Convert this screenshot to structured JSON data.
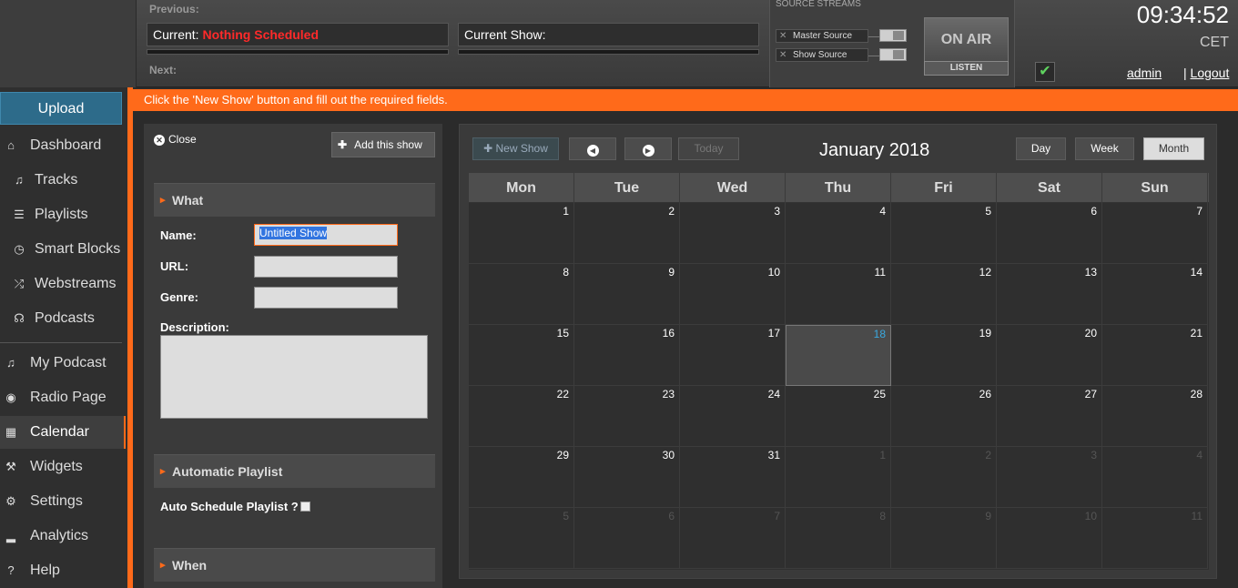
{
  "header": {
    "previous_label": "Previous:",
    "next_label": "Next:",
    "current_label": "Current:",
    "current_value": "Nothing Scheduled",
    "current_show_label": "Current Show:",
    "source_streams_title": "SOURCE STREAMS",
    "master_source": "Master Source",
    "show_source": "Show Source",
    "on_air": "ON AIR",
    "listen": "LISTEN",
    "time": "09:34:52",
    "timezone": "CET",
    "user": "admin",
    "logout_sep": "|",
    "logout": "Logout"
  },
  "sidebar": {
    "upload": "Upload",
    "items": [
      {
        "label": "Dashboard",
        "icon": "home-icon",
        "glyph": "⌂"
      },
      {
        "label": "Tracks",
        "icon": "music-note-icon",
        "glyph": "♫"
      },
      {
        "label": "Playlists",
        "icon": "list-icon",
        "glyph": "☰"
      },
      {
        "label": "Smart Blocks",
        "icon": "clock-icon",
        "glyph": "◷"
      },
      {
        "label": "Webstreams",
        "icon": "shuffle-icon",
        "glyph": "⤮"
      },
      {
        "label": "Podcasts",
        "icon": "headphones-icon",
        "glyph": "☊"
      },
      {
        "label": "My Podcast",
        "icon": "music-note-icon",
        "glyph": "♫"
      },
      {
        "label": "Radio Page",
        "icon": "globe-icon",
        "glyph": "◉"
      },
      {
        "label": "Calendar",
        "icon": "calendar-icon",
        "glyph": "▦"
      },
      {
        "label": "Widgets",
        "icon": "wrench-icon",
        "glyph": "⚒"
      },
      {
        "label": "Settings",
        "icon": "gear-icon",
        "glyph": "⚙"
      },
      {
        "label": "Analytics",
        "icon": "bar-chart-icon",
        "glyph": "▂"
      },
      {
        "label": "Help",
        "icon": "help-icon",
        "glyph": "?"
      }
    ],
    "active": "Calendar"
  },
  "notice": "Click the 'New Show' button and fill out the required fields.",
  "form": {
    "close": "Close",
    "add_show": "Add this show",
    "section_what": "What",
    "name_label": "Name:",
    "name_value": "Untitled Show",
    "url_label": "URL:",
    "genre_label": "Genre:",
    "description_label": "Description:",
    "section_playlist": "Automatic Playlist",
    "auto_schedule_label": "Auto Schedule Playlist ?",
    "section_when": "When"
  },
  "calendar": {
    "new_show": "New Show",
    "today": "Today",
    "title": "January 2018",
    "view_day": "Day",
    "view_week": "Week",
    "view_month": "Month",
    "active_view": "Month",
    "day_names": [
      "Mon",
      "Tue",
      "Wed",
      "Thu",
      "Fri",
      "Sat",
      "Sun"
    ],
    "weeks": [
      [
        "1",
        "2",
        "3",
        "4",
        "5",
        "6",
        "7"
      ],
      [
        "8",
        "9",
        "10",
        "11",
        "12",
        "13",
        "14"
      ],
      [
        "15",
        "16",
        "17",
        "18",
        "19",
        "20",
        "21"
      ],
      [
        "22",
        "23",
        "24",
        "25",
        "26",
        "27",
        "28"
      ],
      [
        "29",
        "30",
        "31",
        "1",
        "2",
        "3",
        "4"
      ],
      [
        "5",
        "6",
        "7",
        "8",
        "9",
        "10",
        "11"
      ]
    ],
    "today_date": "18",
    "colors": {
      "accent": "#ff6a1a",
      "today_text": "#3aa9e0",
      "upload": "#2d6b8a"
    }
  }
}
